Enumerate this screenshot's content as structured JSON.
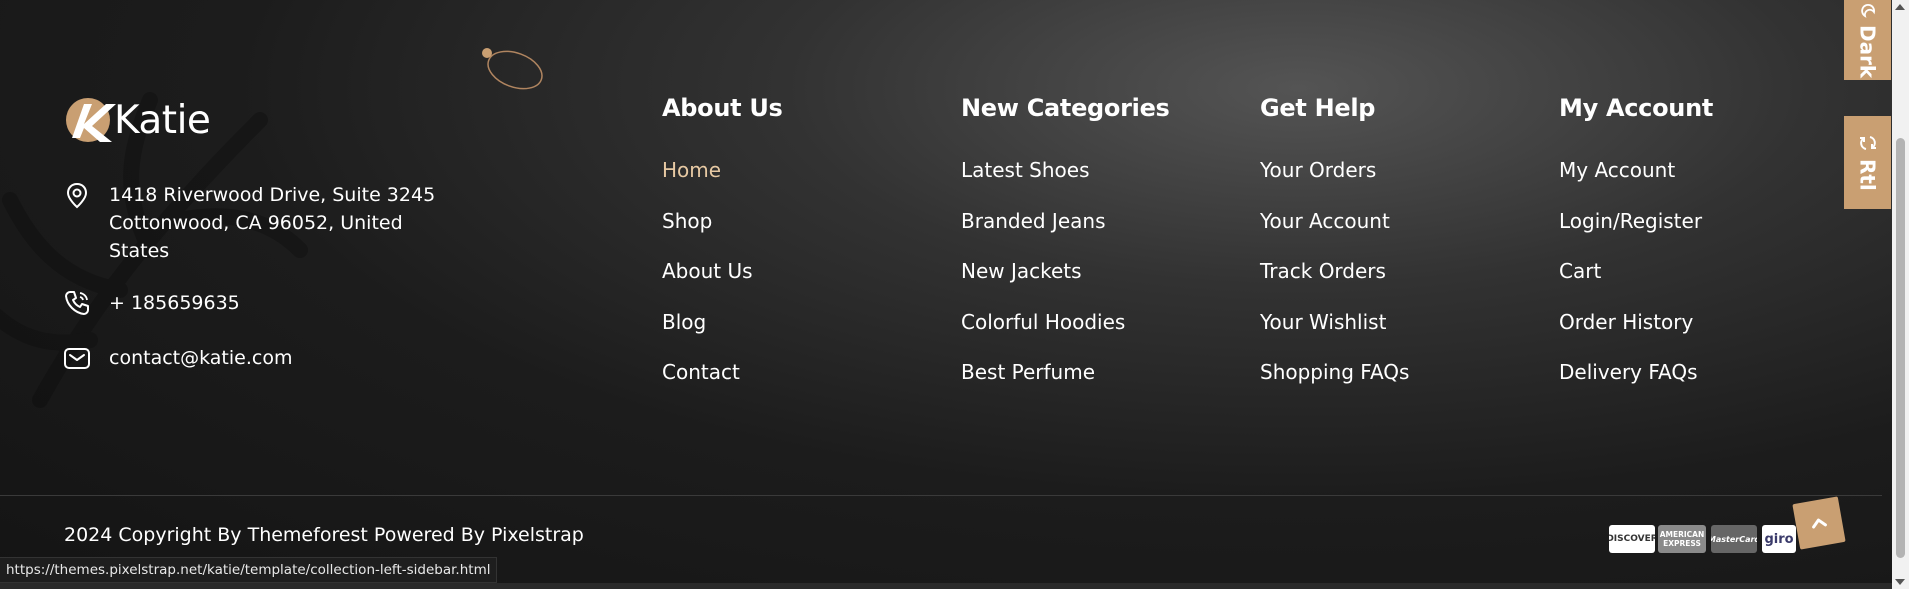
{
  "brand": {
    "name": "Katie"
  },
  "contact": {
    "address": "1418 Riverwood Drive, Suite 3245 Cottonwood, CA 96052, United States",
    "phone": "+ 185659635",
    "email": "contact@katie.com"
  },
  "columns": [
    {
      "title": "About Us",
      "links": [
        "Home",
        "Shop",
        "About Us",
        "Blog",
        "Contact"
      ]
    },
    {
      "title": "New Categories",
      "links": [
        "Latest Shoes",
        "Branded Jeans",
        "New Jackets",
        "Colorful Hoodies",
        "Best Perfume"
      ]
    },
    {
      "title": "Get Help",
      "links": [
        "Your Orders",
        "Your Account",
        "Track Orders",
        "Your Wishlist",
        "Shopping FAQs"
      ]
    },
    {
      "title": "My Account",
      "links": [
        "My Account",
        "Login/Register",
        "Cart",
        "Order History",
        "Delivery FAQs"
      ]
    }
  ],
  "copyright": "2024 Copyright By Themeforest Powered By Pixelstrap",
  "payments": [
    "DISCOVER",
    "AMERICAN EXPRESS",
    "MasterCard",
    "giro"
  ],
  "side_buttons": {
    "dark": "Dark",
    "rtl": "Rtl"
  },
  "status_url": "https://themes.pixelstrap.net/katie/template/collection-left-sidebar.html",
  "colors": {
    "accent": "#c99f72",
    "active_link": "#e7c9a3",
    "background": "#1c1c1c"
  },
  "icons": [
    "location-pin-icon",
    "phone-icon",
    "mail-icon",
    "chevron-up-icon",
    "moon-icon",
    "refresh-icon"
  ]
}
